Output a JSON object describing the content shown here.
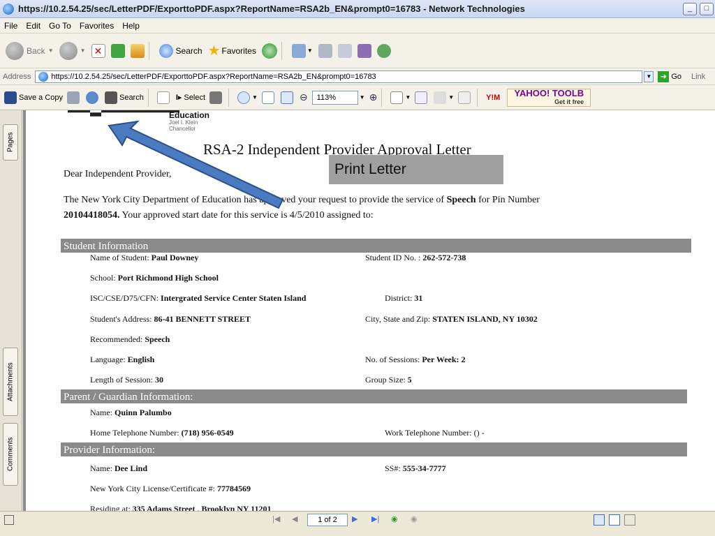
{
  "window": {
    "title": "https://10.2.54.25/sec/LetterPDF/ExporttoPDF.aspx?ReportName=RSA2b_EN&prompt0=16783 - Network Technologies",
    "minimize": "_",
    "maximize": "□"
  },
  "menu": [
    "File",
    "Edit",
    "Go To",
    "Favorites",
    "Help"
  ],
  "toolbar": {
    "back": "Back",
    "search": "Search",
    "favorites": "Favorites"
  },
  "address": {
    "label": "Address",
    "url": "https://10.2.54.25/sec/LetterPDF/ExporttoPDF.aspx?ReportName=RSA2b_EN&prompt0=16783",
    "go": "Go",
    "links": "Link"
  },
  "pdf_toolbar": {
    "save_copy": "Save a Copy",
    "search": "Search",
    "select": "Select",
    "zoom": "113%",
    "yahoo_brand": "YAHOO! TOOLB",
    "yahoo_sub": "Get it free"
  },
  "left_tabs": [
    "Pages",
    "Attachments",
    "Comments"
  ],
  "doc": {
    "logo_text": "Education",
    "chancellor_name": "Joel I. Klein",
    "chancellor_title": "Chancellor",
    "title": "RSA-2 Independent Provider Approval Letter",
    "print_button": "Print Letter",
    "greeting": "Dear Independent Provider,",
    "para_1a": "The New York City Department of Education has approved your request to provide the service of ",
    "para_service": "Speech",
    "para_1b": " for Pin Number",
    "para_pin": "20104418054.",
    "para_2": " Your approved start date for this service is 4/5/2010 assigned to:",
    "student_section": "Student Information",
    "student": {
      "name_label": "Name of Student:",
      "name": "Paul Downey",
      "id_label": "Student ID No. :",
      "id": "262-572-738",
      "school_label": "School:",
      "school": "Port Richmond High School",
      "isc_label": "ISC/CSE/D75/CFN:",
      "isc": "Intergrated Service Center Staten Island",
      "district_label": "District:",
      "district": "31",
      "address_label": "Student's Address:",
      "address": "86-41 BENNETT STREET",
      "csz_label": "City, State and Zip:",
      "csz": "STATEN ISLAND, NY 10302",
      "recommended_label": "Recommended:",
      "recommended": "Speech",
      "language_label": "Language:",
      "language": "English",
      "sessions_label": "No. of Sessions:",
      "sessions": "Per Week: 2",
      "length_label": "Length of Session:",
      "length": "30",
      "group_label": "Group Size:",
      "group": "5"
    },
    "parent_section": "Parent / Guardian Information:",
    "parent": {
      "name_label": "Name:",
      "name": "Quinn Palumbo",
      "home_label": "Home Telephone Number:",
      "home": "(718) 956-0549",
      "work_label": "Work Telephone Number:",
      "work": "() -"
    },
    "provider_section": "Provider Information:",
    "provider": {
      "name_label": "Name:",
      "name": "Dee Lind",
      "ssn_label": "SS#:",
      "ssn": "555-34-7777",
      "license_label": "New York City License/Certificate #:",
      "license": "77784569",
      "residing_label": "Residing at:",
      "residing": "335 Adams Street , Brooklyn NY 11201"
    }
  },
  "nav": {
    "page_indicator": "1 of 2"
  }
}
